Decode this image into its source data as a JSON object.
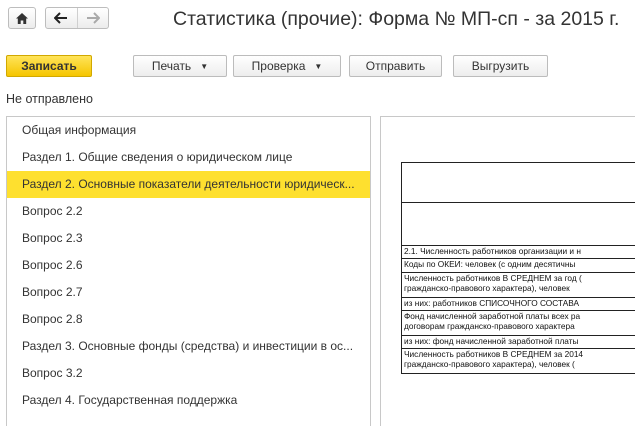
{
  "window": {
    "title": "Статистика (прочие): Форма № МП-сп - за 2015 г."
  },
  "nav": {
    "home_icon": "home-icon",
    "back_icon": "arrow-left-icon",
    "forward_icon": "arrow-right-icon"
  },
  "toolbar": {
    "save_label": "Записать",
    "print_label": "Печать",
    "check_label": "Проверка",
    "send_label": "Отправить",
    "export_label": "Выгрузить"
  },
  "status_text": "Не отправлено",
  "sections": [
    {
      "label": "Общая информация",
      "selected": false
    },
    {
      "label": "Раздел 1. Общие сведения о юридическом лице",
      "selected": false
    },
    {
      "label": "Раздел 2. Основные показатели деятельности юридическ...",
      "selected": true
    },
    {
      "label": "Вопрос 2.2",
      "selected": false
    },
    {
      "label": "Вопрос 2.3",
      "selected": false
    },
    {
      "label": "Вопрос 2.6",
      "selected": false
    },
    {
      "label": "Вопрос 2.7",
      "selected": false
    },
    {
      "label": "Вопрос 2.8",
      "selected": false
    },
    {
      "label": "Раздел 3. Основные фонды (средства) и инвестиции в ос...",
      "selected": false
    },
    {
      "label": "Вопрос 3.2",
      "selected": false
    },
    {
      "label": "Раздел 4. Государственная поддержка",
      "selected": false
    }
  ],
  "document": {
    "rows": [
      {
        "lines": [
          ""
        ]
      },
      {
        "lines": [
          ""
        ]
      },
      {
        "lines": [
          "2.1. Численность работников организации и н"
        ]
      },
      {
        "lines": [
          "Коды по ОКЕИ: человек (с одним десятичны"
        ]
      },
      {
        "lines": [
          "Численность работников В СРЕДНЕМ за год (",
          "гражданско-правового характера), человек"
        ]
      },
      {
        "lines": [
          "из них: работников СПИСОЧНОГО СОСТАВА"
        ]
      },
      {
        "lines": [
          "Фонд начисленной заработной платы всех ра",
          "договорам гражданско-правового характера"
        ]
      },
      {
        "lines": [
          "из них: фонд начисленной заработной платы"
        ]
      },
      {
        "lines": [
          "Численность работников В СРЕДНЕМ за 2014",
          "гражданско-правового характера), человек ("
        ]
      }
    ]
  },
  "colors": {
    "accent": "#fee02f",
    "primary_button": "#f5c500"
  }
}
